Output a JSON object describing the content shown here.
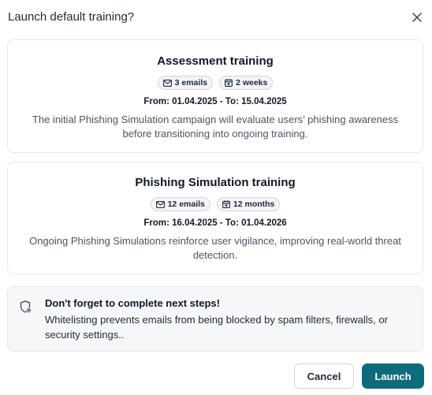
{
  "dialog": {
    "title": "Launch default training?",
    "close_icon": "close-icon"
  },
  "cards": [
    {
      "title": "Assessment training",
      "badges": [
        {
          "icon": "mail-icon",
          "label": "3 emails"
        },
        {
          "icon": "calendar-icon",
          "label": "2 weeks"
        }
      ],
      "dates": "From: 01.04.2025 - To: 15.04.2025",
      "description": "The initial Phishing Simulation campaign will evaluate users’ phishing awareness before transitioning into ongoing training."
    },
    {
      "title": "Phishing Simulation training",
      "badges": [
        {
          "icon": "mail-icon",
          "label": "12 emails"
        },
        {
          "icon": "calendar-icon",
          "label": "12 months"
        }
      ],
      "dates": "From: 16.04.2025 - To: 01.04.2026",
      "description": "Ongoing Phishing Simulations reinforce user vigilance, improving real-world threat detection."
    }
  ],
  "notice": {
    "icon": "shield-gear-icon",
    "title": "Don't forget to complete next steps!",
    "text": "Whitelisting prevents emails from being blocked by spam filters, firewalls, or security settings.."
  },
  "actions": {
    "cancel_label": "Cancel",
    "launch_label": "Launch",
    "launch_color": "#0e6b7c"
  }
}
